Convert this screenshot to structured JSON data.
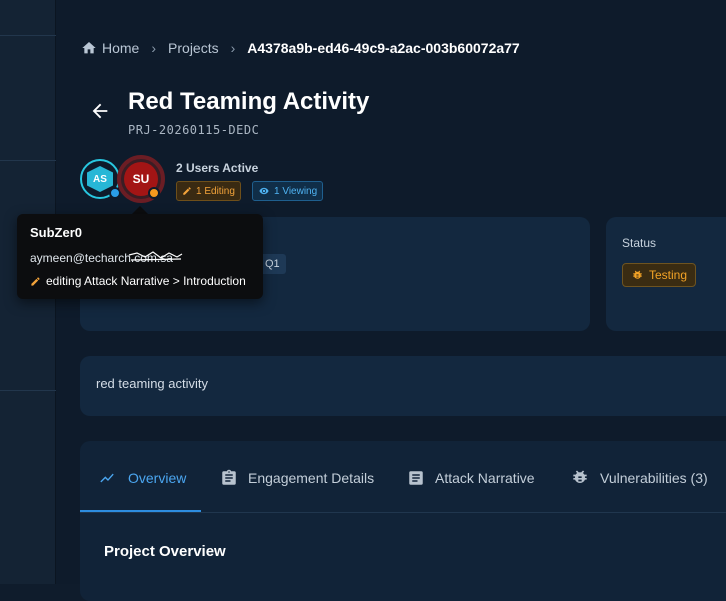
{
  "breadcrumb": {
    "home": "Home",
    "projects": "Projects",
    "current": "A4378a9b-ed46-49c9-a2ac-003b60072a77"
  },
  "project": {
    "title": "Red Teaming Activity",
    "code": "PRJ-20260115-DEDC",
    "description": "red teaming activity"
  },
  "presence": {
    "users_active": "2 Users Active",
    "editing_badge": "1 Editing",
    "viewing_badge": "1 Viewing",
    "avatars": [
      {
        "initials": "AS",
        "status_color": "#2a9ee8"
      },
      {
        "initials": "SU",
        "status_color": "#f59a1e"
      }
    ]
  },
  "tooltip": {
    "name": "SubZer0",
    "email": "aymeen@techarch.com.sa",
    "activity": "editing Attack Narrative > Introduction"
  },
  "info": {
    "chip": "Q1",
    "status_label": "Status",
    "status_value": "Testing"
  },
  "tabs": [
    {
      "label": "Overview",
      "icon": "trend-line-icon",
      "active": true
    },
    {
      "label": "Engagement Details",
      "icon": "clipboard-icon",
      "active": false
    },
    {
      "label": "Attack Narrative",
      "icon": "document-icon",
      "active": false
    },
    {
      "label": "Vulnerabilities (3)",
      "icon": "bug-icon",
      "active": false
    }
  ],
  "section": {
    "title": "Project Overview"
  },
  "colors": {
    "accent": "#2d8de0",
    "testing": "#f3a326",
    "background": "#0e1b2b",
    "card": "#13283f"
  }
}
